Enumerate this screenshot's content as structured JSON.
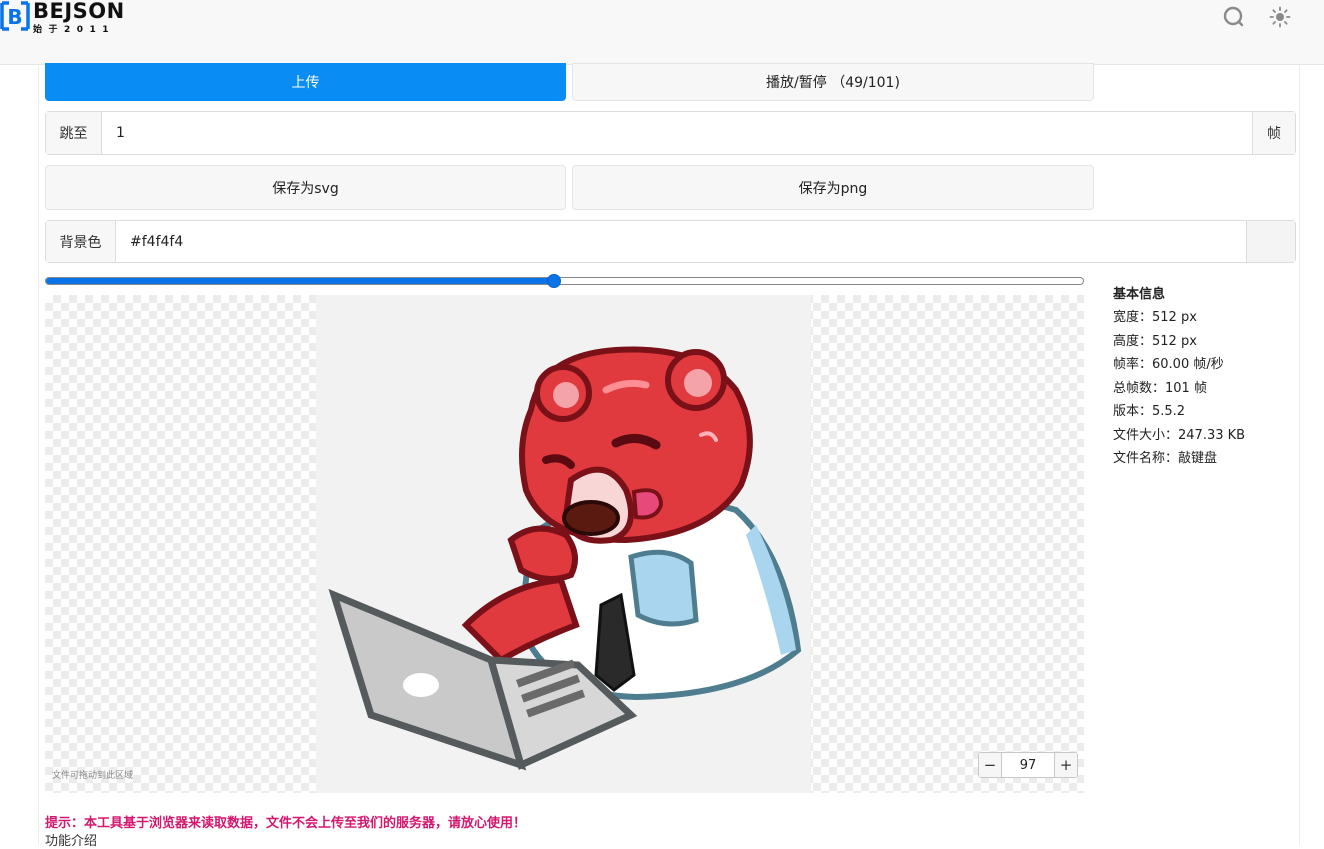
{
  "header": {
    "logo_title": "BEJSON",
    "logo_subtitle": "始于2011",
    "logo_mark_letter": "B",
    "accent_color": "#0a73e8",
    "icons": [
      "search-icon",
      "theme-toggle-icon"
    ]
  },
  "controls": {
    "upload_label": "上传",
    "play_pause_label": "播放/暂停 （49/101)",
    "jump_label": "跳至",
    "jump_value": "1",
    "jump_suffix": "帧",
    "save_svg_label": "保存为svg",
    "save_png_label": "保存为png",
    "bg_label": "背景色",
    "bg_value": "#f4f4f4",
    "progress_fraction": 0.49
  },
  "preview": {
    "drop_hint": "文件可拖动到此区域",
    "zoom_minus": "−",
    "zoom_plus": "+",
    "zoom_value": "97"
  },
  "info": {
    "title": "基本信息",
    "rows": [
      "宽度：512 px",
      "高度：512 px",
      "帧率：60.00 帧/秒",
      "总帧数：101 帧",
      "版本：5.5.2",
      "文件大小：247.33 KB",
      "文件名称：敲键盘"
    ]
  },
  "notice": {
    "text": "提示：本工具基于浏览器来读取数据，文件不会上传至我们的服务器，请放心使用！",
    "color": "#d5176f",
    "next_line": "功能介绍"
  }
}
